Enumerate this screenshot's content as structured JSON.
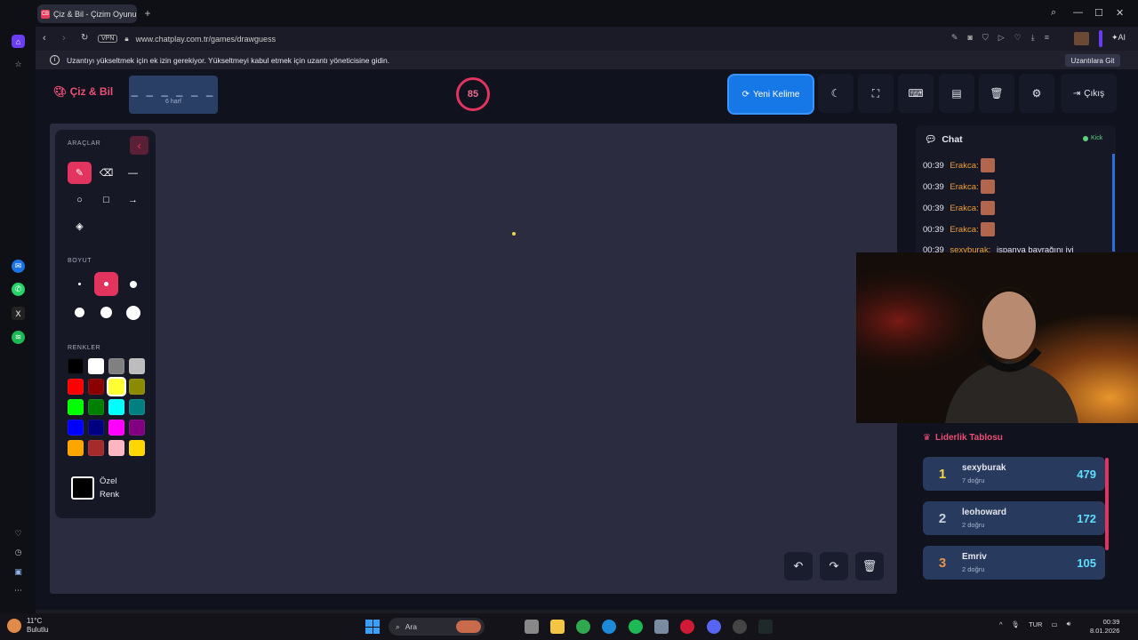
{
  "browser": {
    "tab_title": "Çiz & Bil - Çizim Oyunu",
    "tab_favicon": "CB",
    "url": "www.chatplay.com.tr/games/drawguess",
    "vpn_label": "VPN",
    "info_message": "Uzantıyı yükseltmek için ek izin gerekiyor. Yükseltmeyi kabul etmek için uzantı yöneticisine gidin.",
    "info_button": "Uzantılara Git",
    "ai_label": "AI"
  },
  "header": {
    "logo": "Çiz & Bil",
    "word_dashes": "_ _ _ _ _ _",
    "word_hint": "6 harf",
    "timer": "85",
    "new_word_label": "Yeni Kelime",
    "exit_label": "Çıkış"
  },
  "tools": {
    "tools_title": "ARAÇLAR",
    "size_title": "BOYUT",
    "colors_title": "RENKLER",
    "custom_color_label_1": "Özel",
    "custom_color_label_2": "Renk",
    "colors": [
      "#000000",
      "#ffffff",
      "#808080",
      "#bdbdbd",
      "#ff0000",
      "#8b0000",
      "#ffff33",
      "#8b8b00",
      "#00ff00",
      "#008000",
      "#00ffff",
      "#008080",
      "#0000ff",
      "#000080",
      "#ff00ff",
      "#800080",
      "#ffa500",
      "#a52a2a",
      "#ffb6c1",
      "#ffd700"
    ]
  },
  "chat": {
    "title": "Chat",
    "kick_label": "Kick",
    "messages": [
      {
        "time": "00:39",
        "user": "Erakca:"
      },
      {
        "time": "00:39",
        "user": "Erakca:"
      },
      {
        "time": "00:39",
        "user": "Erakca:"
      },
      {
        "time": "00:39",
        "user": "Erakca:"
      },
      {
        "time": "00:39",
        "user": "sexyburak:",
        "text": "ispanya bayrağını iyi"
      }
    ]
  },
  "leaderboard": {
    "title": "Liderlik Tablosu",
    "rows": [
      {
        "rank": "1",
        "name": "sexyburak",
        "sub": "7 doğru",
        "score": "479",
        "rank_color": "#f5d442"
      },
      {
        "rank": "2",
        "name": "leohoward",
        "sub": "2 doğru",
        "score": "172",
        "rank_color": "#c9d0dc"
      },
      {
        "rank": "3",
        "name": "Emriv",
        "sub": "2 doğru",
        "score": "105",
        "rank_color": "#e8954a"
      }
    ]
  },
  "taskbar": {
    "temperature": "11°C",
    "weather": "Bulutlu",
    "search_placeholder": "Ara",
    "lang": "TUR",
    "time": "00:39",
    "date": "8.01.2026"
  },
  "colors": {
    "accent": "#e2345e",
    "primary": "#1677e6",
    "canvas_bg": "#2c2c40"
  }
}
